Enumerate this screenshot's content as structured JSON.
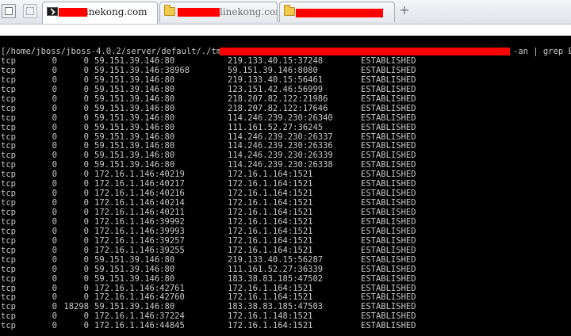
{
  "tabs": [
    {
      "label": "linekong.com",
      "active": true,
      "icon": "terminal-icon"
    },
    {
      "label": "linekong.com",
      "active": false,
      "icon": "folder-icon"
    },
    {
      "label": "",
      "active": false,
      "icon": "folder-icon"
    }
  ],
  "new_tab_label": "+",
  "terminal": {
    "command_prefix": "[/home/jboss/jboss-4.0.2/server/default/./tmp/",
    "command_suffix": "-an | grep E",
    "rows": [
      {
        "proto": "tcp",
        "recvq": "0",
        "sendq": "0",
        "local": "59.151.39.146:80",
        "foreign": "219.133.40.15:37248",
        "state": "ESTABLISHED"
      },
      {
        "proto": "tcp",
        "recvq": "0",
        "sendq": "0",
        "local": "59.151.39.146:38968",
        "foreign": "59.151.39.146:8080",
        "state": "ESTABLISHED"
      },
      {
        "proto": "tcp",
        "recvq": "0",
        "sendq": "0",
        "local": "59.151.39.146:80",
        "foreign": "219.133.40.15:56461",
        "state": "ESTABLISHED"
      },
      {
        "proto": "tcp",
        "recvq": "0",
        "sendq": "0",
        "local": "59.151.39.146:80",
        "foreign": "123.151.42.46:56999",
        "state": "ESTABLISHED"
      },
      {
        "proto": "tcp",
        "recvq": "0",
        "sendq": "0",
        "local": "59.151.39.146:80",
        "foreign": "218.207.82.122:21986",
        "state": "ESTABLISHED"
      },
      {
        "proto": "tcp",
        "recvq": "0",
        "sendq": "0",
        "local": "59.151.39.146:80",
        "foreign": "218.207.82.122:17646",
        "state": "ESTABLISHED"
      },
      {
        "proto": "tcp",
        "recvq": "0",
        "sendq": "0",
        "local": "59.151.39.146:80",
        "foreign": "114.246.239.230:26340",
        "state": "ESTABLISHED"
      },
      {
        "proto": "tcp",
        "recvq": "0",
        "sendq": "0",
        "local": "59.151.39.146:80",
        "foreign": "111.161.52.27:36245",
        "state": "ESTABLISHED"
      },
      {
        "proto": "tcp",
        "recvq": "0",
        "sendq": "0",
        "local": "59.151.39.146:80",
        "foreign": "114.246.239.230:26337",
        "state": "ESTABLISHED"
      },
      {
        "proto": "tcp",
        "recvq": "0",
        "sendq": "0",
        "local": "59.151.39.146:80",
        "foreign": "114.246.239.230:26336",
        "state": "ESTABLISHED"
      },
      {
        "proto": "tcp",
        "recvq": "0",
        "sendq": "0",
        "local": "59.151.39.146:80",
        "foreign": "114.246.239.230:26339",
        "state": "ESTABLISHED"
      },
      {
        "proto": "tcp",
        "recvq": "0",
        "sendq": "0",
        "local": "59.151.39.146:80",
        "foreign": "114.246.239.230:26338",
        "state": "ESTABLISHED"
      },
      {
        "proto": "tcp",
        "recvq": "0",
        "sendq": "0",
        "local": "172.16.1.146:40219",
        "foreign": "172.16.1.164:1521",
        "state": "ESTABLISHED"
      },
      {
        "proto": "tcp",
        "recvq": "0",
        "sendq": "0",
        "local": "172.16.1.146:40217",
        "foreign": "172.16.1.164:1521",
        "state": "ESTABLISHED"
      },
      {
        "proto": "tcp",
        "recvq": "0",
        "sendq": "0",
        "local": "172.16.1.146:40216",
        "foreign": "172.16.1.164:1521",
        "state": "ESTABLISHED"
      },
      {
        "proto": "tcp",
        "recvq": "0",
        "sendq": "0",
        "local": "172.16.1.146:40214",
        "foreign": "172.16.1.164:1521",
        "state": "ESTABLISHED"
      },
      {
        "proto": "tcp",
        "recvq": "0",
        "sendq": "0",
        "local": "172.16.1.146:40211",
        "foreign": "172.16.1.164:1521",
        "state": "ESTABLISHED"
      },
      {
        "proto": "tcp",
        "recvq": "0",
        "sendq": "0",
        "local": "172.16.1.146:39992",
        "foreign": "172.16.1.164:1521",
        "state": "ESTABLISHED"
      },
      {
        "proto": "tcp",
        "recvq": "0",
        "sendq": "0",
        "local": "172.16.1.146:39993",
        "foreign": "172.16.1.164:1521",
        "state": "ESTABLISHED"
      },
      {
        "proto": "tcp",
        "recvq": "0",
        "sendq": "0",
        "local": "172.16.1.146:39257",
        "foreign": "172.16.1.164:1521",
        "state": "ESTABLISHED"
      },
      {
        "proto": "tcp",
        "recvq": "0",
        "sendq": "0",
        "local": "172.16.1.146:39255",
        "foreign": "172.16.1.164:1521",
        "state": "ESTABLISHED"
      },
      {
        "proto": "tcp",
        "recvq": "0",
        "sendq": "0",
        "local": "59.151.39.146:80",
        "foreign": "219.133.40.15:56287",
        "state": "ESTABLISHED"
      },
      {
        "proto": "tcp",
        "recvq": "0",
        "sendq": "0",
        "local": "59.151.39.146:80",
        "foreign": "111.161.52.27:36339",
        "state": "ESTABLISHED"
      },
      {
        "proto": "tcp",
        "recvq": "0",
        "sendq": "0",
        "local": "59.151.39.146:80",
        "foreign": "183.38.83.185:47502",
        "state": "ESTABLISHED"
      },
      {
        "proto": "tcp",
        "recvq": "0",
        "sendq": "0",
        "local": "172.16.1.146:42761",
        "foreign": "172.16.1.164:1521",
        "state": "ESTABLISHED"
      },
      {
        "proto": "tcp",
        "recvq": "0",
        "sendq": "0",
        "local": "172.16.1.146:42760",
        "foreign": "172.16.1.164:1521",
        "state": "ESTABLISHED"
      },
      {
        "proto": "tcp",
        "recvq": "0",
        "sendq": "18298",
        "local": "59.151.39.146:80",
        "foreign": "183.38.83.185:47503",
        "state": "ESTABLISHED"
      },
      {
        "proto": "tcp",
        "recvq": "0",
        "sendq": "0",
        "local": "172.16.1.146:37224",
        "foreign": "172.16.1.148:1521",
        "state": "ESTABLISHED"
      },
      {
        "proto": "tcp",
        "recvq": "0",
        "sendq": "0",
        "local": "172.16.1.146:44845",
        "foreign": "172.16.1.164:1521",
        "state": "ESTABLISHED"
      }
    ]
  }
}
